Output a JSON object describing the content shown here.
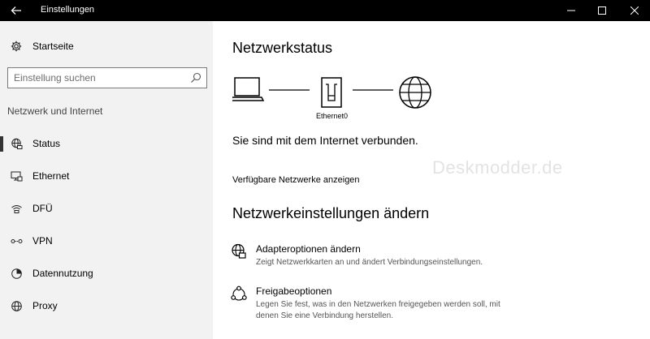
{
  "window": {
    "title": "Einstellungen"
  },
  "sidebar": {
    "home_label": "Startseite",
    "search": {
      "placeholder": "Einstellung suchen"
    },
    "section_title": "Netzwerk und Internet",
    "items": [
      {
        "label": "Status",
        "icon": "globe-network-icon",
        "active": true
      },
      {
        "label": "Ethernet",
        "icon": "ethernet-monitor-icon"
      },
      {
        "label": "DFÜ",
        "icon": "dialup-icon"
      },
      {
        "label": "VPN",
        "icon": "vpn-icon"
      },
      {
        "label": "Datennutzung",
        "icon": "data-usage-icon"
      },
      {
        "label": "Proxy",
        "icon": "globe-icon"
      }
    ]
  },
  "main": {
    "status_title": "Netzwerkstatus",
    "adapter_label": "Ethernet0",
    "connection_message": "Sie sind mit dem Internet verbunden.",
    "watermark": "Deskmodder.de",
    "networks_link": "Verfügbare Netzwerke anzeigen",
    "settings_title": "Netzwerkeinstellungen ändern",
    "options": [
      {
        "title": "Adapteroptionen ändern",
        "desc": "Zeigt Netzwerkkarten an und ändert Verbindungseinstellungen.",
        "icon": "adapter-globe-icon"
      },
      {
        "title": "Freigabeoptionen",
        "desc": "Legen Sie fest, was in den Netzwerken freigegeben werden soll, mit denen Sie eine Verbindung herstellen.",
        "icon": "share-icon"
      }
    ]
  },
  "colors": {
    "titlebar": "#000000",
    "sidebar_bg": "#f2f2f2",
    "main_bg": "#ffffff"
  }
}
